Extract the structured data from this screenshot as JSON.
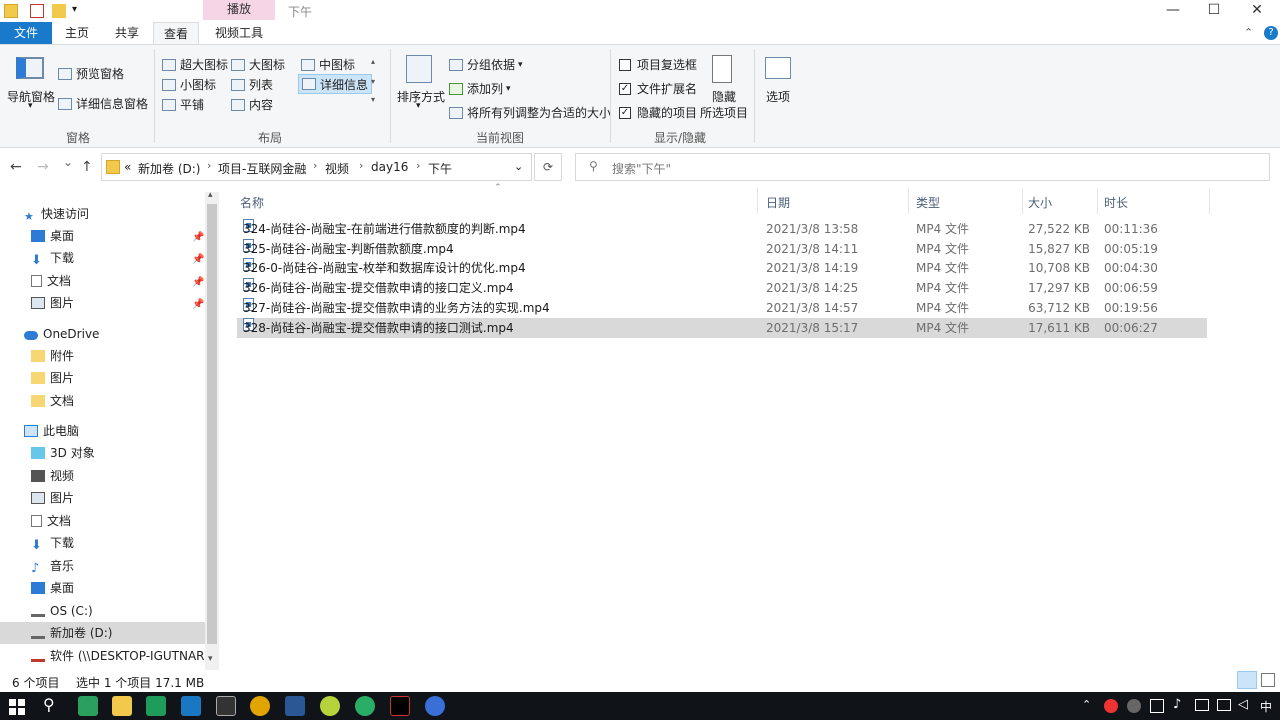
{
  "titlebar": {
    "context_tab_header": "播放",
    "title": "下午",
    "minimize": "—",
    "maximize": "☐",
    "close": "✕"
  },
  "tabs": {
    "file": "文件",
    "home": "主页",
    "share": "共享",
    "view": "查看",
    "video_tools": "视频工具"
  },
  "ribbon": {
    "panes": {
      "nav_pane": "导航窗格",
      "preview_pane": "预览窗格",
      "details_pane": "详细信息窗格",
      "label": "窗格"
    },
    "layout": {
      "extra_large": "超大图标",
      "large": "大图标",
      "medium": "中图标",
      "small": "小图标",
      "list": "列表",
      "details": "详细信息",
      "tiles": "平铺",
      "content": "内容",
      "label": "布局"
    },
    "current_view": {
      "sort_by": "排序方式",
      "group_by": "分组依据",
      "add_columns": "添加列",
      "fit_columns": "将所有列调整为合适的大小",
      "label": "当前视图"
    },
    "show_hide": {
      "item_checkboxes": "项目复选框",
      "file_extensions": "文件扩展名",
      "hidden_items": "隐藏的项目",
      "hide_selected_line1": "隐藏",
      "hide_selected_line2": "所选项目",
      "label": "显示/隐藏"
    },
    "options": "选项"
  },
  "address": {
    "back": "←",
    "forward": "→",
    "recent": "⌄",
    "up": "↑",
    "overflow": "«",
    "crumbs": [
      "新加卷 (D:)",
      "项目-互联网金融",
      "视频",
      "day16",
      "下午"
    ],
    "refresh": "⟳",
    "search_placeholder": "搜索\"下午\""
  },
  "navpane": {
    "quick_access": "快速访问",
    "qa_items": [
      "桌面",
      "下载",
      "文档",
      "图片"
    ],
    "onedrive": "OneDrive",
    "od_items": [
      "附件",
      "图片",
      "文档"
    ],
    "this_pc": "此电脑",
    "pc_items": [
      "3D 对象",
      "视频",
      "图片",
      "文档",
      "下载",
      "音乐",
      "桌面",
      "OS (C:)",
      "新加卷 (D:)",
      "软件 (\\\\DESKTOP-IGUTNAR)"
    ]
  },
  "filelist": {
    "columns": {
      "name": "名称",
      "date": "日期",
      "type": "类型",
      "size": "大小",
      "length": "时长"
    },
    "rows": [
      {
        "name": "324-尚硅谷-尚融宝-在前端进行借款额度的判断.mp4",
        "date": "2021/3/8 13:58",
        "type": "MP4 文件",
        "size": "27,522 KB",
        "length": "00:11:36"
      },
      {
        "name": "325-尚硅谷-尚融宝-判断借款额度.mp4",
        "date": "2021/3/8 14:11",
        "type": "MP4 文件",
        "size": "15,827 KB",
        "length": "00:05:19"
      },
      {
        "name": "326-0-尚硅谷-尚融宝-枚举和数据库设计的优化.mp4",
        "date": "2021/3/8 14:19",
        "type": "MP4 文件",
        "size": "10,708 KB",
        "length": "00:04:30"
      },
      {
        "name": "326-尚硅谷-尚融宝-提交借款申请的接口定义.mp4",
        "date": "2021/3/8 14:25",
        "type": "MP4 文件",
        "size": "17,297 KB",
        "length": "00:06:59"
      },
      {
        "name": "327-尚硅谷-尚融宝-提交借款申请的业务方法的实现.mp4",
        "date": "2021/3/8 14:57",
        "type": "MP4 文件",
        "size": "63,712 KB",
        "length": "00:19:56"
      },
      {
        "name": "328-尚硅谷-尚融宝-提交借款申请的接口测试.mp4",
        "date": "2021/3/8 15:17",
        "type": "MP4 文件",
        "size": "17,611 KB",
        "length": "00:06:27"
      }
    ]
  },
  "status": {
    "count": "6 个项目",
    "selected": "选中 1 个项目  17.1 MB"
  },
  "taskbar": {
    "ime": "中"
  },
  "colors": {
    "file_tab": "#1979ca",
    "context_tab": "#f6d5e7",
    "selection": "#d9d9d9",
    "taskbar": "#101419"
  }
}
